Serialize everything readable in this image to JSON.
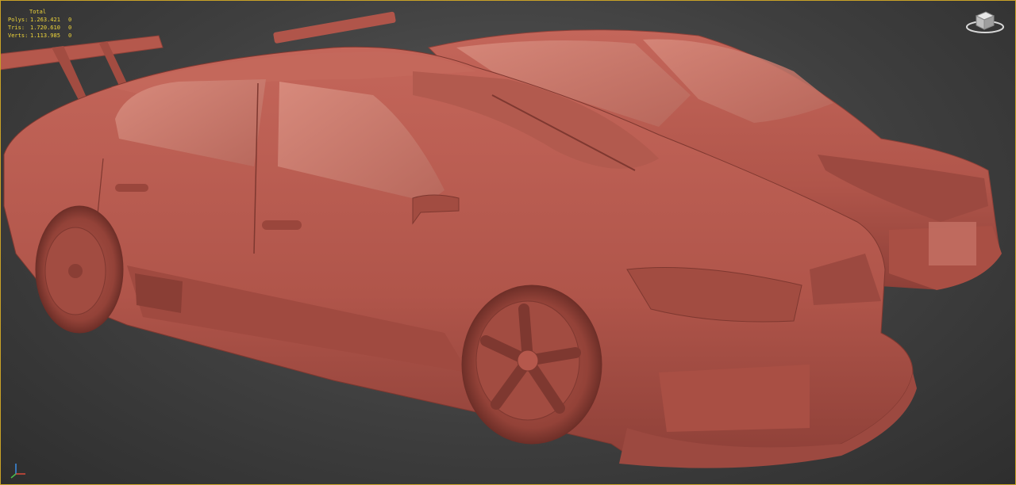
{
  "stats": {
    "title": "Total",
    "rows": [
      {
        "label": "Polys:",
        "value": "1.263.421",
        "selected": "0"
      },
      {
        "label": "Tris:",
        "value": "1.720.610",
        "selected": "0"
      },
      {
        "label": "Verts:",
        "value": "1.113.985",
        "selected": "0"
      }
    ]
  },
  "viewcube": {
    "icon": "viewcube-icon"
  },
  "axis": {
    "icon": "axis-tripod-icon"
  },
  "colors": {
    "clay": "#b5584c",
    "clay_dark": "#7e3830",
    "clay_light": "#cf7a6c",
    "background": "#4a4a4a",
    "stats_text": "#f0d63a",
    "viewport_border": "#c9a227"
  }
}
